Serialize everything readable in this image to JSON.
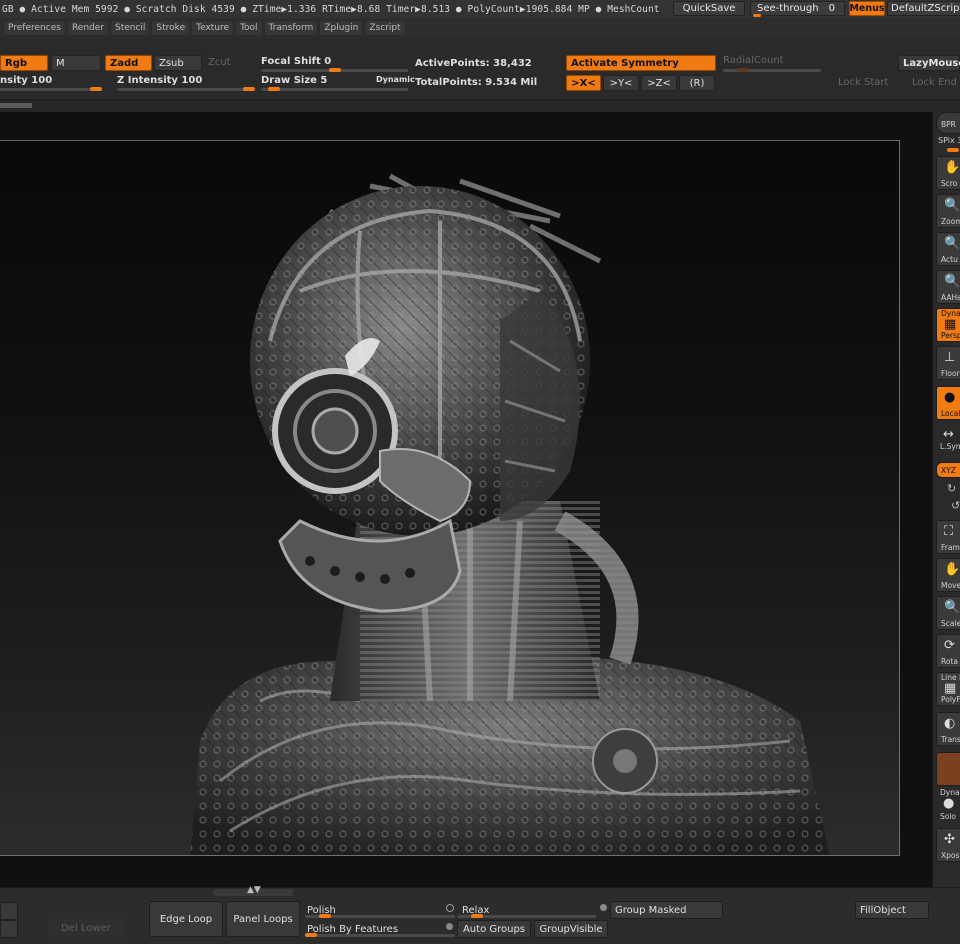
{
  "status_bar": {
    "text": "GB ● Active Mem 5992 ● Scratch Disk 4539 ● ZTime▶1.336 RTime▶8.68 Timer▶8.513 ● PolyCount▶1905.884 MP ● MeshCount",
    "quicksave": "QuickSave",
    "see_through": "See-through",
    "see_through_value": "0",
    "menus": "Menus",
    "default_zscript": "DefaultZScript"
  },
  "menu_bar": {
    "items": [
      "Preferences",
      "Render",
      "Stencil",
      "Stroke",
      "Texture",
      "Tool",
      "Transform",
      "Zplugin",
      "Zscript"
    ]
  },
  "shelf": {
    "rgb": "Rgb",
    "m": "M",
    "zadd": "Zadd",
    "zsub": "Zsub",
    "zcut": "Zcut",
    "focal_shift": "Focal Shift",
    "focal_shift_value": "0",
    "focal_shift_level": 0.5,
    "rgb_intensity": "nsity",
    "rgb_intensity_value": "100",
    "rgb_intensity_level": 1.0,
    "z_intensity": "Z Intensity",
    "z_intensity_value": "100",
    "z_intensity_level": 1.0,
    "draw_size": "Draw Size",
    "draw_size_value": "5",
    "draw_size_level": 0.05,
    "dynamic": "Dynamic",
    "active_points_label": "ActivePoints:",
    "active_points": "38,432",
    "total_points_label": "TotalPoints:",
    "total_points": "9.534 Mil",
    "activate_symmetry": "Activate Symmetry",
    "radial_count": "RadialCount",
    "x_axis": ">X<",
    "y_axis": ">Y<",
    "z_axis": ">Z<",
    "r_axis": "(R)",
    "lazy_mouse": "LazyMouse",
    "lock_start": "Lock Start",
    "lock_end": "Lock End"
  },
  "right_tray": {
    "bpr": "BPR",
    "spix": "SPix",
    "spix_value": "3",
    "scroll": "Scro",
    "zoom": "Zoom",
    "actual": "Actu",
    "aahalf": "AAHa",
    "persp_top": "Dynam",
    "persp": "Persp",
    "floor": "Floor",
    "local": "Local",
    "lsym": "L.Sym",
    "xyz": "XYZ",
    "frame": "Fram",
    "move": "Move",
    "scale": "Scale",
    "rotate": "Rota",
    "line_fill": "Line F",
    "polyf": "PolyF",
    "transp": "Trans",
    "solo_top": "Dyna",
    "solo": "Solo",
    "xpose": "Xpos"
  },
  "bottom_bar": {
    "del_lower": "Del Lower",
    "edge_loop": "Edge Loop",
    "panel_loops": "Panel Loops",
    "polish": "Polish",
    "polish_level": 0.1,
    "polish_by_features": "Polish By Features",
    "relax": "Relax",
    "relax_level": 0.1,
    "auto_groups": "Auto Groups",
    "group_visible": "GroupVisible",
    "group_masked": "Group Masked",
    "fill_object": "FillObject"
  },
  "colors": {
    "accent": "#f07a14",
    "panel": "#2b2b2b",
    "canvas_top": "#090909",
    "canvas_bottom": "#2c2c2c"
  }
}
